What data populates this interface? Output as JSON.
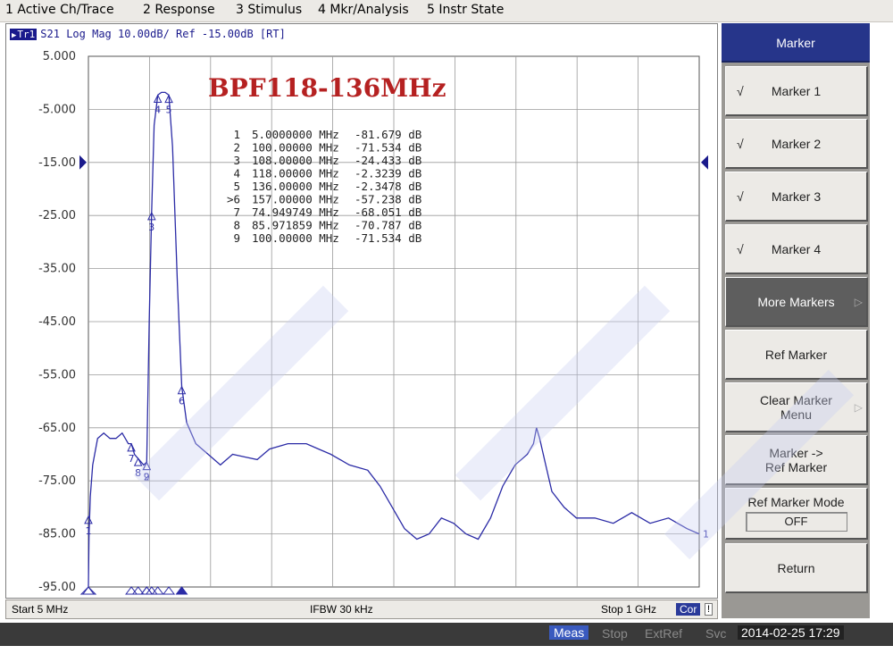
{
  "menu": [
    {
      "label": "1 Active Ch/Trace"
    },
    {
      "label": "2 Response"
    },
    {
      "label": "3 Stimulus"
    },
    {
      "label": "4 Mkr/Analysis"
    },
    {
      "label": "5 Instr State"
    }
  ],
  "trace_header": {
    "flag": "Tr1",
    "text": "S21 Log Mag 10.00dB/ Ref -15.00dB [RT]"
  },
  "plot_title": "BPF118-136MHz",
  "colors": {
    "trace": "#2b2ba6",
    "title": "#b52121",
    "menu_active": "#26358a",
    "ref_marker": "#1a1a8c"
  },
  "chart_data": {
    "type": "line",
    "title": "BPF118-136MHz",
    "x_start_label": "Start 5 MHz",
    "x_stop_label": "Stop 1 GHz",
    "xlim": [
      5,
      1000
    ],
    "ylim": [
      -95,
      5
    ],
    "y_ticks": [
      "5.000",
      "-5.000",
      "-15.00",
      "-25.00",
      "-35.00",
      "-45.00",
      "-55.00",
      "-65.00",
      "-75.00",
      "-85.00",
      "-95.00"
    ],
    "reference_level": -15,
    "scale_db_per_div": 10,
    "grid": true,
    "markers": [
      {
        "id": "1",
        "freq": "5.0000000 MHz",
        "value": "-81.679 dB",
        "x": 5,
        "y": -81.679
      },
      {
        "id": "2",
        "freq": "100.00000 MHz",
        "value": "-71.534 dB",
        "x": 100,
        "y": -71.534
      },
      {
        "id": "3",
        "freq": "108.00000 MHz",
        "value": "-24.433 dB",
        "x": 108,
        "y": -24.433
      },
      {
        "id": "4",
        "freq": "118.00000 MHz",
        "value": "-2.3239 dB",
        "x": 118,
        "y": -2.3239
      },
      {
        "id": "5",
        "freq": "136.00000 MHz",
        "value": "-2.3478 dB",
        "x": 136,
        "y": -2.3478
      },
      {
        "id": ">6",
        "freq": "157.00000 MHz",
        "value": "-57.238 dB",
        "x": 157,
        "y": -57.238
      },
      {
        "id": "7",
        "freq": "74.949749 MHz",
        "value": "-68.051 dB",
        "x": 74.95,
        "y": -68.051
      },
      {
        "id": "8",
        "freq": "85.971859 MHz",
        "value": "-70.787 dB",
        "x": 85.97,
        "y": -70.787
      },
      {
        "id": "9",
        "freq": "100.00000 MHz",
        "value": "-71.534 dB",
        "x": 100,
        "y": -71.534
      }
    ],
    "series": [
      {
        "points": [
          [
            5,
            -95
          ],
          [
            6,
            -85
          ],
          [
            8,
            -78
          ],
          [
            12,
            -72
          ],
          [
            20,
            -67
          ],
          [
            30,
            -66
          ],
          [
            40,
            -67
          ],
          [
            50,
            -67
          ],
          [
            60,
            -66
          ],
          [
            70,
            -68
          ],
          [
            75,
            -68
          ],
          [
            80,
            -70
          ],
          [
            86,
            -70.8
          ],
          [
            95,
            -72
          ],
          [
            100,
            -71.5
          ],
          [
            104,
            -45
          ],
          [
            108,
            -24.4
          ],
          [
            112,
            -8
          ],
          [
            118,
            -2.3
          ],
          [
            124,
            -1.8
          ],
          [
            130,
            -1.8
          ],
          [
            136,
            -2.3
          ],
          [
            142,
            -12
          ],
          [
            150,
            -38
          ],
          [
            157,
            -57.2
          ],
          [
            165,
            -64
          ],
          [
            180,
            -68
          ],
          [
            200,
            -70
          ],
          [
            220,
            -72
          ],
          [
            240,
            -70
          ],
          [
            260,
            -70.5
          ],
          [
            280,
            -71
          ],
          [
            300,
            -69
          ],
          [
            330,
            -68
          ],
          [
            360,
            -68
          ],
          [
            380,
            -69
          ],
          [
            400,
            -70
          ],
          [
            430,
            -72
          ],
          [
            460,
            -73
          ],
          [
            480,
            -76
          ],
          [
            500,
            -80
          ],
          [
            520,
            -84
          ],
          [
            540,
            -86
          ],
          [
            560,
            -85
          ],
          [
            580,
            -82
          ],
          [
            600,
            -83
          ],
          [
            620,
            -85
          ],
          [
            640,
            -86
          ],
          [
            660,
            -82
          ],
          [
            680,
            -76
          ],
          [
            700,
            -72
          ],
          [
            720,
            -70
          ],
          [
            730,
            -68
          ],
          [
            735,
            -65
          ],
          [
            740,
            -67
          ],
          [
            750,
            -72
          ],
          [
            760,
            -77
          ],
          [
            780,
            -80
          ],
          [
            800,
            -82
          ],
          [
            830,
            -82
          ],
          [
            860,
            -83
          ],
          [
            890,
            -81
          ],
          [
            920,
            -83
          ],
          [
            950,
            -82
          ],
          [
            980,
            -84
          ],
          [
            1000,
            -85
          ]
        ]
      }
    ]
  },
  "status": {
    "start": "Start 5 MHz",
    "ifbw": "IFBW 30 kHz",
    "stop": "Stop 1 GHz",
    "cor": "Cor",
    "excl": "!"
  },
  "bottom_bar": {
    "meas": "Meas",
    "stop": "Stop",
    "extref": "ExtRef",
    "svc": "Svc",
    "datetime": "2014-02-25 17:29"
  },
  "panel": {
    "title": "Marker",
    "keys": [
      {
        "label": "Marker 1",
        "check": "√"
      },
      {
        "label": "Marker 2",
        "check": "√"
      },
      {
        "label": "Marker 3",
        "check": "√"
      },
      {
        "label": "Marker 4",
        "check": "√"
      },
      {
        "label": "More Markers",
        "arrow": "▷"
      },
      {
        "label": "Ref Marker"
      },
      {
        "label1": "Clear Marker",
        "label2": "Menu",
        "arrow": "▷"
      },
      {
        "label1": "Marker ->",
        "label2": "Ref Marker"
      },
      {
        "label1": "Ref Marker Mode",
        "value": "OFF"
      },
      {
        "label": "Return"
      }
    ]
  }
}
